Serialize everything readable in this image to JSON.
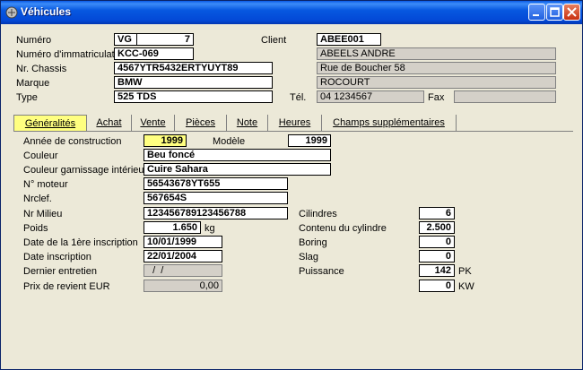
{
  "window": {
    "title": "Véhicules"
  },
  "header": {
    "numero_label": "Numéro",
    "numero_prefix": "VG",
    "numero_value": "7",
    "immat_label": "Numéro d'immatriculat",
    "immat_value": "KCC-069",
    "chassis_label": "Nr. Chassis",
    "chassis_value": "4567YTR5432ERTYUYT89",
    "marque_label": "Marque",
    "marque_value": "BMW",
    "type_label": "Type",
    "type_value": "525 TDS",
    "client_label": "Client",
    "client_code": "ABEE001",
    "client_name": "ABEELS ANDRE",
    "client_street": "Rue de Boucher 58",
    "client_city": "ROCOURT",
    "tel_label": "Tél.",
    "tel_value": "04 1234567",
    "fax_label": "Fax",
    "fax_value": ""
  },
  "tabs": [
    "Généralités",
    "Achat",
    "Vente",
    "Pièces",
    "Note",
    "Heures",
    "Champs supplémentaires"
  ],
  "general": {
    "annee_label": "Année de construction",
    "annee_value": "1999",
    "modele_label": "Modèle",
    "modele_value": "1999",
    "couleur_label": "Couleur",
    "couleur_value": "Beu foncé",
    "garnissage_label": "Couleur garnissage intérieu",
    "garnissage_value": "Cuire Sahara",
    "moteur_label": "N° moteur",
    "moteur_value": "56543678YT655",
    "nrclef_label": "Nrclef.",
    "nrclef_value": "567654S",
    "milieu_label": "Nr Milieu",
    "milieu_value": "123456789123456788",
    "poids_label": "Poids",
    "poids_value": "1.650",
    "poids_unit": "kg",
    "inscription1_label": "Date de la 1ère inscription",
    "inscription1_value": "10/01/1999",
    "inscription_label": "Date inscription",
    "inscription_value": "22/01/2004",
    "entretien_label": "Dernier entretien",
    "entretien_value": "  /  /",
    "prix_label": "Prix de revient EUR",
    "prix_value": "0,00",
    "cilindres_label": "Cilindres",
    "cilindres_value": "6",
    "contenu_label": "Contenu du cylindre",
    "contenu_value": "2.500",
    "boring_label": "Boring",
    "boring_value": "0",
    "slag_label": "Slag",
    "slag_value": "0",
    "puissance_label": "Puissance",
    "puissance_pk": "142",
    "puissance_pk_unit": "PK",
    "puissance_kw": "0",
    "puissance_kw_unit": "KW"
  }
}
